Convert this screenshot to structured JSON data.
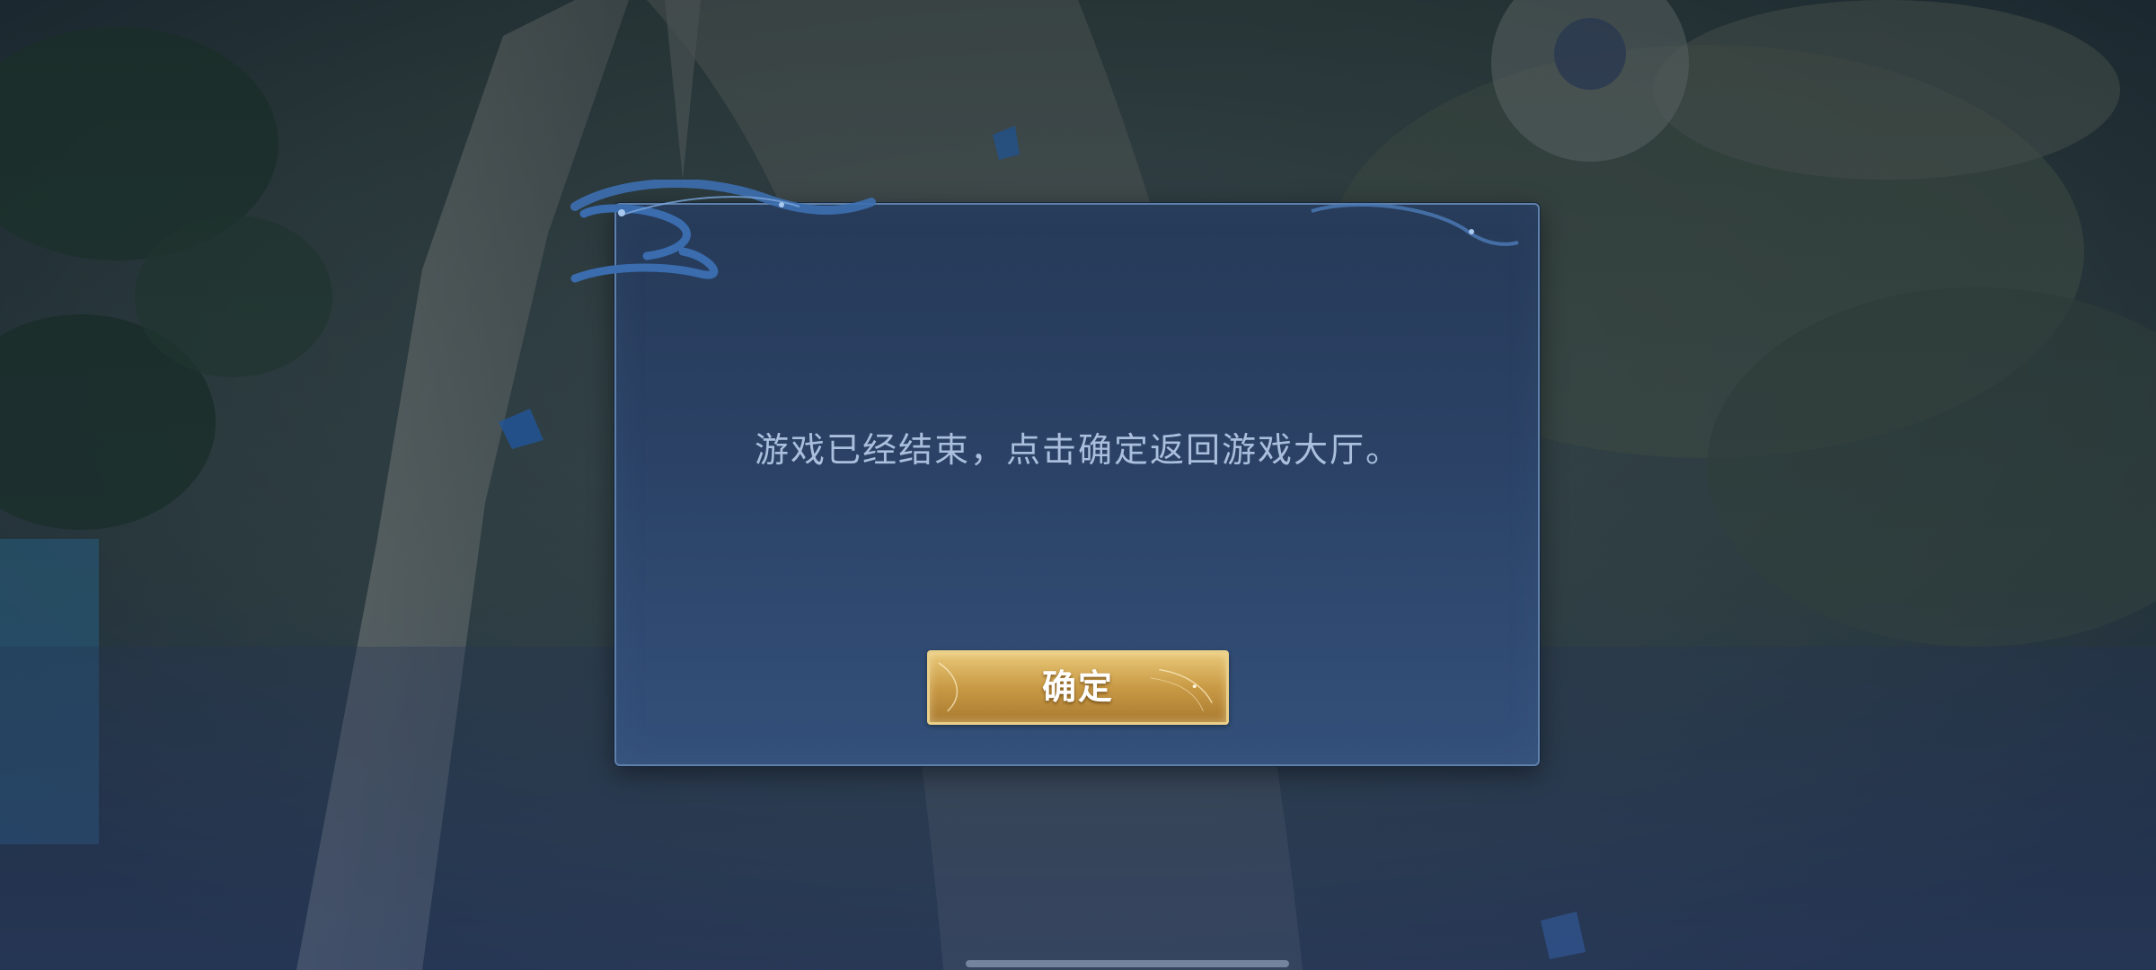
{
  "dialog": {
    "message": "游戏已经结束，点击确定返回游戏大厅。",
    "confirm_label": "确定"
  },
  "colors": {
    "dialog_bg": "#2b4266",
    "dialog_border": "#5f80a8",
    "message_text": "#a9bfdd",
    "button_gold": "#c99a45",
    "button_text": "#ffffff"
  }
}
